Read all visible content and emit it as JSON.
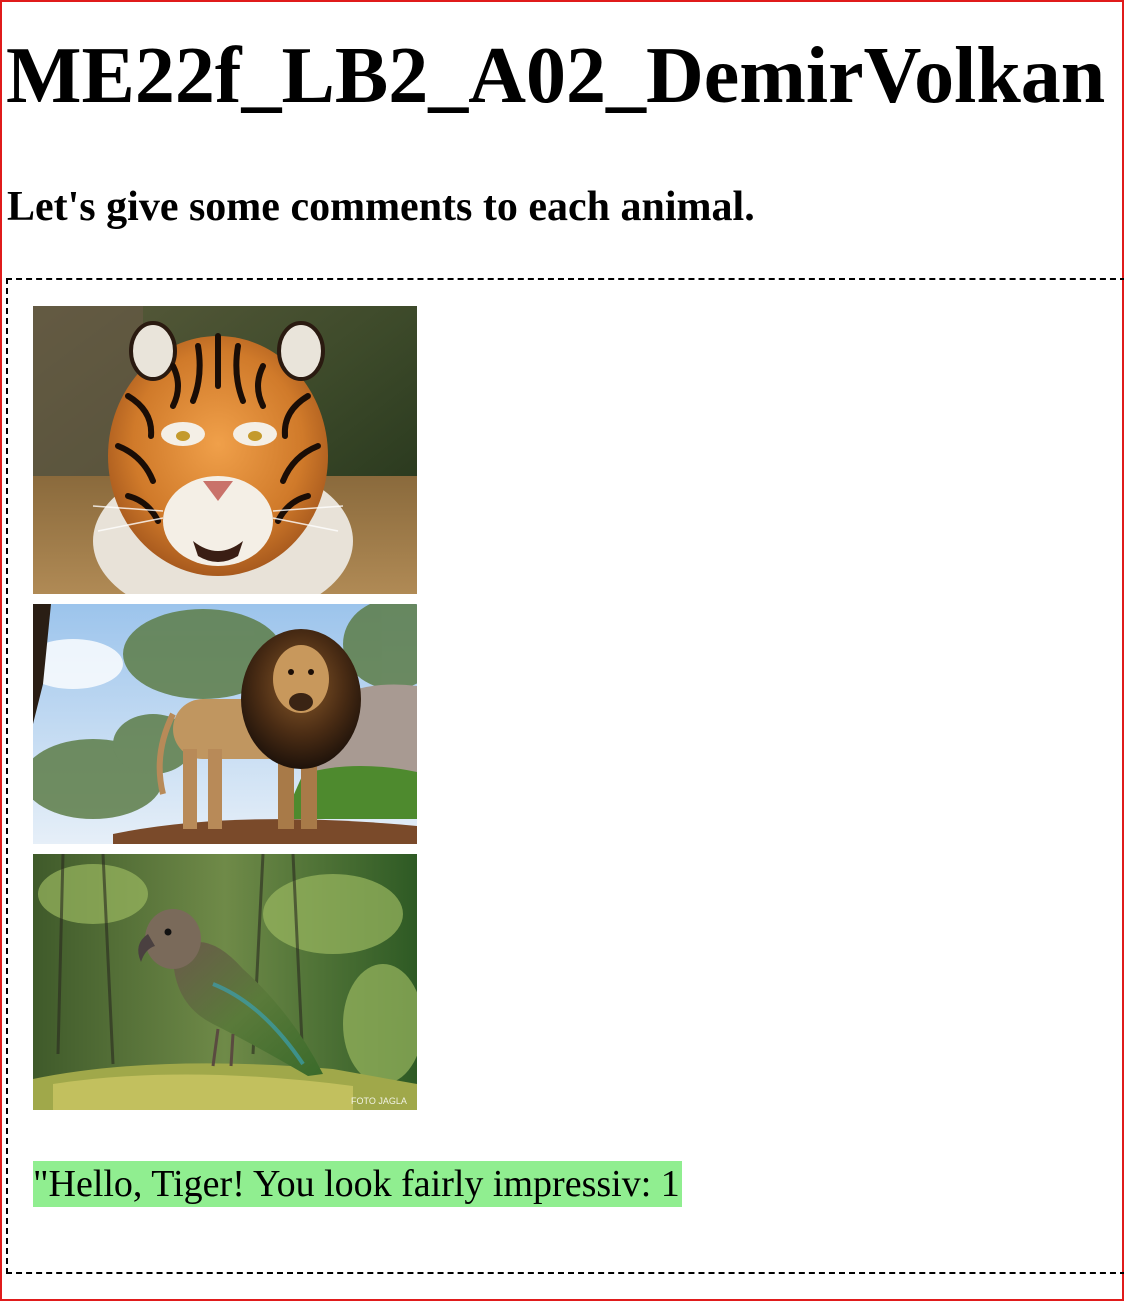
{
  "page": {
    "title": "ME22f_LB2_A02_DemirVolkan",
    "subtitle": "Let's give some comments to each animal."
  },
  "gallery": {
    "images": [
      {
        "name": "tiger",
        "alt": "Tiger"
      },
      {
        "name": "lion",
        "alt": "Lion"
      },
      {
        "name": "kea",
        "alt": "Kea parrot",
        "watermark": "FOTO JAGLA"
      }
    ]
  },
  "comment": {
    "text": "\"Hello, Tiger! You look fairly impressiv: 1",
    "background": "#90ee90"
  },
  "colors": {
    "frame_border": "#e01b1b",
    "container_border": "#000000"
  }
}
